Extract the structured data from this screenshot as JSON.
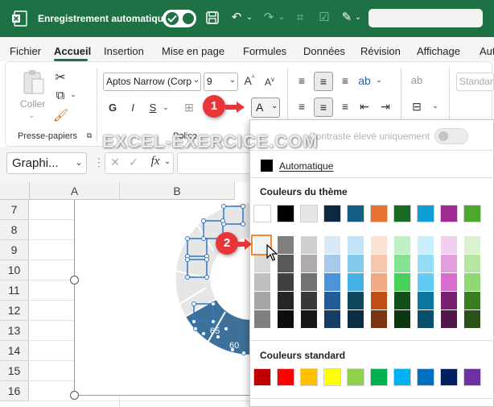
{
  "titlebar": {
    "autosave_label": "Enregistrement automatique",
    "excel_icon": "excel-logo-icon",
    "toggle_state": "on"
  },
  "tabs": [
    "Fichier",
    "Accueil",
    "Insertion",
    "Mise en page",
    "Formules",
    "Données",
    "Révision",
    "Affichage",
    "Aut"
  ],
  "active_tab": "Accueil",
  "ribbon": {
    "clipboard": {
      "paste_label": "Coller",
      "group_label": "Presse-papiers"
    },
    "font": {
      "font_name": "Aptos Narrow (Corp",
      "font_size": "9",
      "bold": "G",
      "italic": "I",
      "strike": "S",
      "color_button": "A",
      "group_label": "Police"
    },
    "number_style": "Standar"
  },
  "formula_bar": {
    "name_box": "Graphi...",
    "cancel": "✕",
    "confirm": "✓",
    "fx": "fx"
  },
  "columns": [
    "A",
    "B"
  ],
  "rows": [
    "7",
    "8",
    "9",
    "10",
    "11",
    "12",
    "13",
    "14",
    "15",
    "16"
  ],
  "chart": {
    "labels": [
      "65",
      "60"
    ]
  },
  "dropdown": {
    "high_contrast_label": "Contraste élevé uniquement",
    "automatic_label": "Automatique",
    "theme_title": "Couleurs du thème",
    "standard_title": "Couleurs standard",
    "theme_colors": [
      "#ffffff",
      "#000000",
      "#e7e6e6",
      "#0e2841",
      "#156082",
      "#e97132",
      "#196b24",
      "#0f9ed5",
      "#a02b93",
      "#4ea72e"
    ],
    "theme_shades": [
      [
        "#f2f2f2",
        "#d9d9d9",
        "#bfbfbf",
        "#a6a6a6",
        "#7f7f7f"
      ],
      [
        "#808080",
        "#595959",
        "#404040",
        "#262626",
        "#0d0d0d"
      ],
      [
        "#d0cece",
        "#afabab",
        "#767171",
        "#3b3838",
        "#171616"
      ],
      [
        "#dae9f8",
        "#a6c9ec",
        "#4d93d9",
        "#215c98",
        "#153d64"
      ],
      [
        "#c0e4f5",
        "#83cbeb",
        "#45b0e1",
        "#0f4761",
        "#0b3041"
      ],
      [
        "#fbe2d5",
        "#f7c7ac",
        "#f1a983",
        "#c04f15",
        "#78350f"
      ],
      [
        "#c1f0c8",
        "#84e291",
        "#47d359",
        "#124f1a",
        "#0c3511"
      ],
      [
        "#caeefb",
        "#95dcf7",
        "#61cbf3",
        "#0b76a0",
        "#074f6a"
      ],
      [
        "#f2ceef",
        "#e59edd",
        "#d86dcd",
        "#782170",
        "#501549"
      ],
      [
        "#daf2d0",
        "#b5e6a2",
        "#8ed973",
        "#3a7d22",
        "#275317"
      ]
    ],
    "standard_colors": [
      "#c00000",
      "#ff0000",
      "#ffc000",
      "#ffff00",
      "#92d050",
      "#00b050",
      "#00b0f0",
      "#0070c0",
      "#002060",
      "#7030a0"
    ]
  },
  "callouts": [
    "1",
    "2"
  ],
  "watermark": "EXCEL-EXERCICE.COM"
}
